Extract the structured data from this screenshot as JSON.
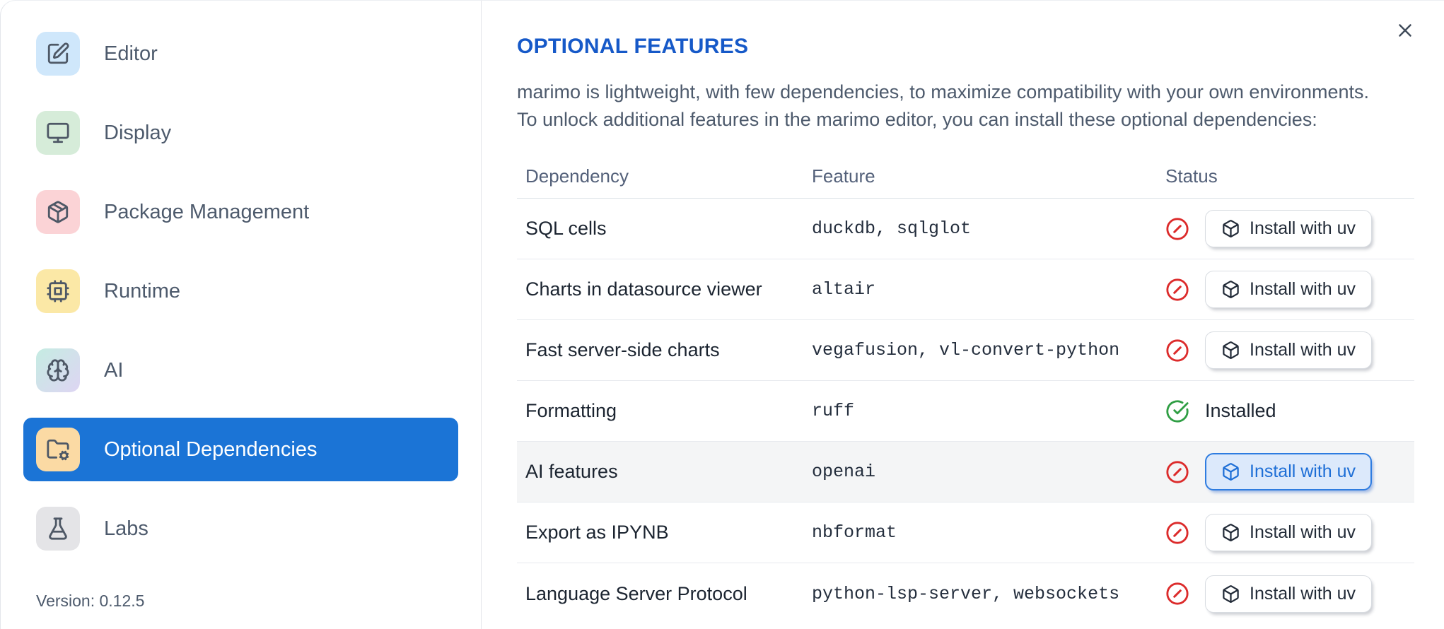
{
  "dialog": {
    "title": "OPTIONAL FEATURES",
    "description_lines": [
      "marimo is lightweight, with few dependencies, to maximize compatibility with your own environments.",
      "To unlock additional features in the marimo editor, you can install these optional dependencies:"
    ]
  },
  "sidebar": {
    "items": [
      {
        "label": "Editor",
        "icon": "square-pen-icon",
        "icon_bg": "#cfe7fb",
        "selected": false
      },
      {
        "label": "Display",
        "icon": "monitor-icon",
        "icon_bg": "#d6ecd9",
        "selected": false
      },
      {
        "label": "Package Management",
        "icon": "package-icon",
        "icon_bg": "#fbd3d6",
        "selected": false
      },
      {
        "label": "Runtime",
        "icon": "cpu-icon",
        "icon_bg": "#fbe8a6",
        "selected": false
      },
      {
        "label": "AI",
        "icon": "brain-icon",
        "icon_bg": "gradient(#c5ece2,#ded5f3)",
        "selected": false
      },
      {
        "label": "Optional Dependencies",
        "icon": "folder-cog-icon",
        "icon_bg": "#fbdaa4",
        "selected": true
      },
      {
        "label": "Labs",
        "icon": "flask-icon",
        "icon_bg": "#e4e4e7",
        "selected": false
      }
    ],
    "version": "Version: 0.12.5"
  },
  "table": {
    "columns": {
      "dependency": "Dependency",
      "feature": "Feature",
      "status": "Status"
    },
    "install_button_label": "Install with uv",
    "installed_label": "Installed",
    "rows": [
      {
        "dependency": "SQL cells",
        "feature": "duckdb, sqlglot",
        "status": "not-installed"
      },
      {
        "dependency": "Charts in datasource viewer",
        "feature": "altair",
        "status": "not-installed"
      },
      {
        "dependency": "Fast server-side charts",
        "feature": "vegafusion, vl-convert-python",
        "status": "not-installed"
      },
      {
        "dependency": "Formatting",
        "feature": "ruff",
        "status": "installed"
      },
      {
        "dependency": "AI features",
        "feature": "openai",
        "status": "not-installed",
        "highlighted": true
      },
      {
        "dependency": "Export as IPYNB",
        "feature": "nbformat",
        "status": "not-installed"
      },
      {
        "dependency": "Language Server Protocol",
        "feature": "python-lsp-server, websockets",
        "status": "not-installed"
      }
    ]
  },
  "colors": {
    "accent_blue": "#1b74d6",
    "title_blue": "#1659c8",
    "error_red": "#dc2b2b",
    "success_green": "#2f9e44",
    "hover_row_bg": "#f4f5f6",
    "focused_button_border": "#2e7ce0",
    "focused_button_bg": "#dce9fb"
  }
}
